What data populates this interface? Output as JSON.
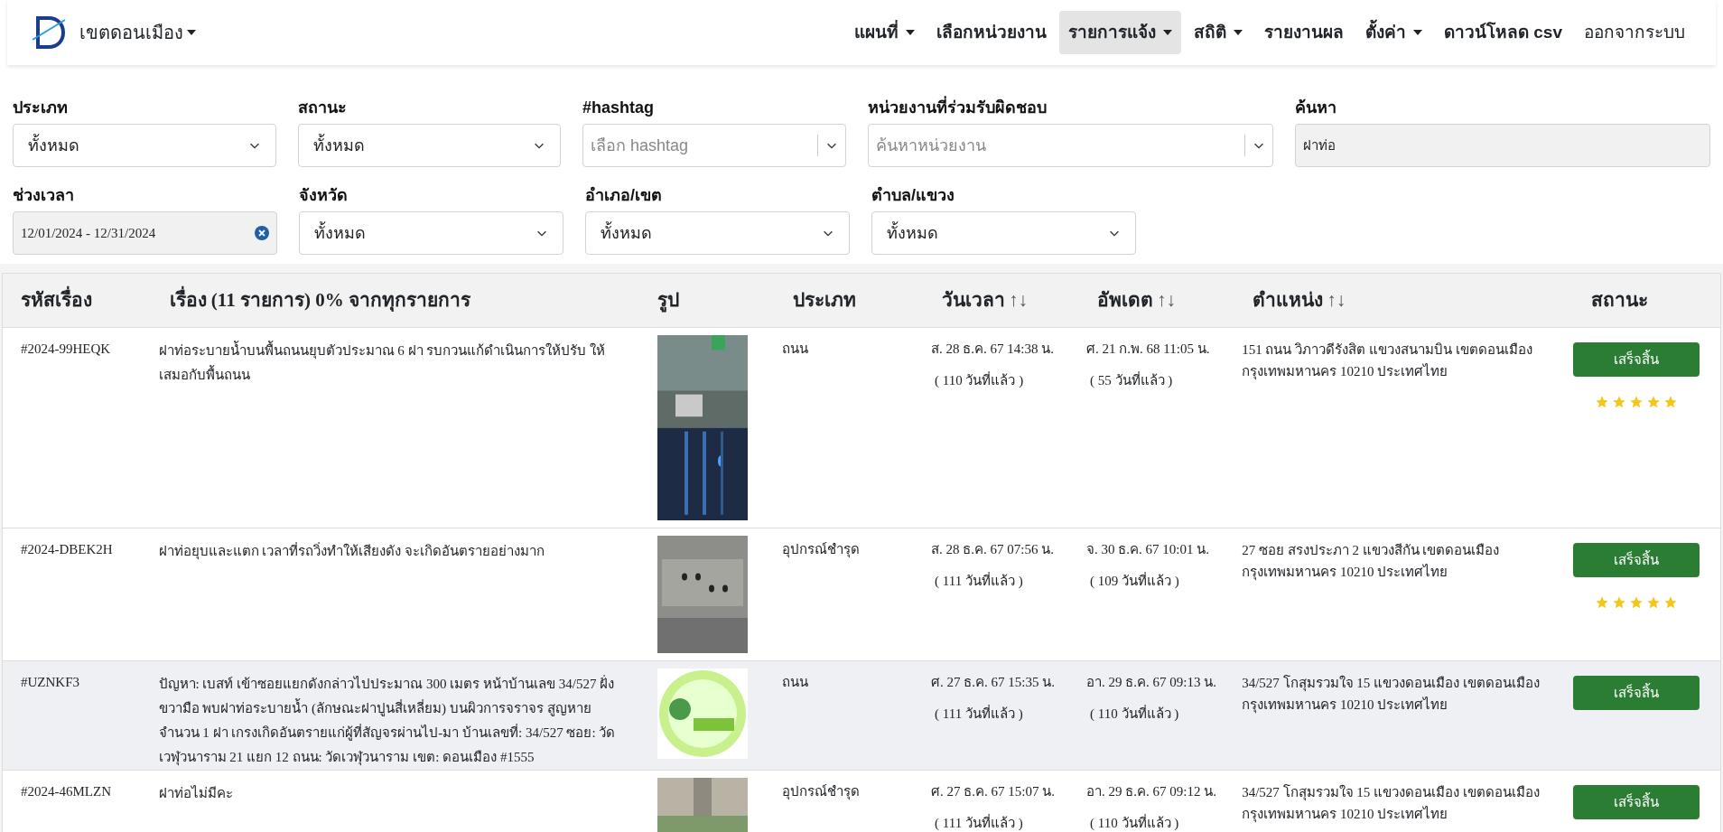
{
  "navbar": {
    "brand": "เขตดอนเมือง",
    "brand_caret": true,
    "items": [
      {
        "label": "แผนที่",
        "dropdown": true,
        "selected": false
      },
      {
        "label": "เลือกหน่วยงาน",
        "dropdown": false,
        "selected": false
      },
      {
        "label": "รายการแจ้ง",
        "dropdown": true,
        "selected": true
      },
      {
        "label": "สถิติ",
        "dropdown": true,
        "selected": false
      },
      {
        "label": "รายงานผล",
        "dropdown": false,
        "selected": false
      },
      {
        "label": "ตั้งค่า",
        "dropdown": true,
        "selected": false
      },
      {
        "label": "ดาวน์โหลด csv",
        "dropdown": false,
        "selected": false
      },
      {
        "label": "ออกจากระบบ",
        "dropdown": false,
        "selected": false,
        "bold": false
      }
    ]
  },
  "filters": [
    [
      {
        "label": "ประเภท",
        "kind": "select",
        "value": "ทั้งหมด"
      },
      {
        "label": "สถานะ",
        "kind": "select",
        "value": "ทั้งหมด"
      },
      {
        "label": "#hashtag",
        "kind": "combo",
        "placeholder": "เลือก hashtag"
      },
      {
        "label": "หน่วยงานที่ร่วมรับผิดชอบ",
        "kind": "combo",
        "placeholder": "ค้นหาหน่วยงาน"
      },
      {
        "label": "ค้นหา",
        "kind": "text",
        "value": "ฝาท่อ"
      }
    ],
    [
      {
        "label": "ช่วงเวลา",
        "kind": "daterange",
        "value": "12/01/2024 - 12/31/2024"
      },
      {
        "label": "จังหวัด",
        "kind": "select",
        "value": "ทั้งหมด"
      },
      {
        "label": "อำเภอ/เขต",
        "kind": "select",
        "value": "ทั้งหมด"
      },
      {
        "label": "ตำบล/แขวง",
        "kind": "select",
        "value": "ทั้งหมด"
      }
    ]
  ],
  "table": {
    "columns": [
      {
        "label": "รหัสเรื่อง",
        "sortable": false
      },
      {
        "label": "เรื่อง (11 รายการ) 0% จากทุกรายการ",
        "sortable": false
      },
      {
        "label": "รูป",
        "sortable": false
      },
      {
        "label": "ประเภท",
        "sortable": false
      },
      {
        "label": "วันเวลา",
        "sortable": true,
        "sort_mark": "↑↓"
      },
      {
        "label": "อัพเดต",
        "sortable": true,
        "sort_mark": "↑↓"
      },
      {
        "label": "ตำแหน่ง",
        "sortable": true,
        "sort_mark": "↑↓"
      },
      {
        "label": "สถานะ",
        "sortable": false
      }
    ],
    "rows": [
      {
        "id": "#2024-99HEQK",
        "title": "ฝาท่อระบายน้ำบนพื้นถนนยุบตัวประมาณ 6 ฝา รบกวนแก้ดำเนินการให้ปรับ ให้เสมอกับพื้นถนน",
        "type": "ถนน",
        "date": "ส. 28 ธ.ค. 67 14:38 น.",
        "date_ago": "( 110 วันที่แล้ว )",
        "updated": "ศ. 21 ก.พ. 68 11:05 น.",
        "updated_ago": "( 55 วันที่แล้ว )",
        "location": "151 ถนน วิภาวดีรังสิต แขวงสนามบิน เขตดอนเมือง กรุงเทพมหานคร 10210 ประเทศไทย",
        "status": "เสร็จสิ้น",
        "stars": 5,
        "highlighted": false
      },
      {
        "id": "#2024-DBEK2H",
        "title": "ฝาท่อยุบและแตก เวลาที่รถวิ่งทำให้เสียงดัง จะเกิดอันตรายอย่างมาก",
        "type": "อุปกรณ์ชำรุด",
        "date": "ส. 28 ธ.ค. 67 07:56 น.",
        "date_ago": "( 111 วันที่แล้ว )",
        "updated": "จ. 30 ธ.ค. 67 10:01 น.",
        "updated_ago": "( 109 วันที่แล้ว )",
        "location": "27 ซอย สรงประภา 2 แขวงสีกัน เขตดอนเมือง กรุงเทพมหานคร 10210 ประเทศไทย",
        "status": "เสร็จสิ้น",
        "stars": 5,
        "highlighted": false
      },
      {
        "id": "#UZNKF3",
        "title": "ปัญหา: เบสท์ เข้าซอยแยกดังกล่าวไปประมาณ 300 เมตร หน้าบ้านเลข 34/527 ฝั่งขวามือ พบฝาท่อระบายน้ำ (ลักษณะฝาปูนสี่เหลี่ยม) บนผิวการจราจร สูญหาย จำนวน 1 ฝา เกรงเกิดอันตรายแก่ผู้ที่สัญจรผ่านไป-มา บ้านเลขที่: 34/527 ซอย: วัดเวฬุวนาราม 21 แยก 12 ถนน: วัดเวฬุวนาราม เขต: ดอนเมือง #1555",
        "type": "ถนน",
        "date": "ศ. 27 ธ.ค. 67 15:35 น.",
        "date_ago": "( 111 วันที่แล้ว )",
        "updated": "อา. 29 ธ.ค. 67 09:13 น.",
        "updated_ago": "( 110 วันที่แล้ว )",
        "location": "34/527 โกสุมรวมใจ 15 แขวงดอนเมือง เขตดอนเมือง กรุงเทพมหานคร 10210 ประเทศไทย",
        "status": "เสร็จสิ้น",
        "highlighted": true
      },
      {
        "id": "#2024-46MLZN",
        "title": "ฝาท่อไม่มีคะ",
        "type": "อุปกรณ์ชำรุด",
        "date": "ศ. 27 ธ.ค. 67 15:07 น.",
        "date_ago": "( 111 วันที่แล้ว )",
        "updated": "อา. 29 ธ.ค. 67 09:12 น.",
        "updated_ago": "( 110 วันที่แล้ว )",
        "location": "34/527 โกสุมรวมใจ 15 แขวงดอนเมือง เขตดอนเมือง กรุงเทพมหานคร 10210 ประเทศไทย",
        "status": "เสร็จสิ้น",
        "highlighted": false
      }
    ]
  }
}
